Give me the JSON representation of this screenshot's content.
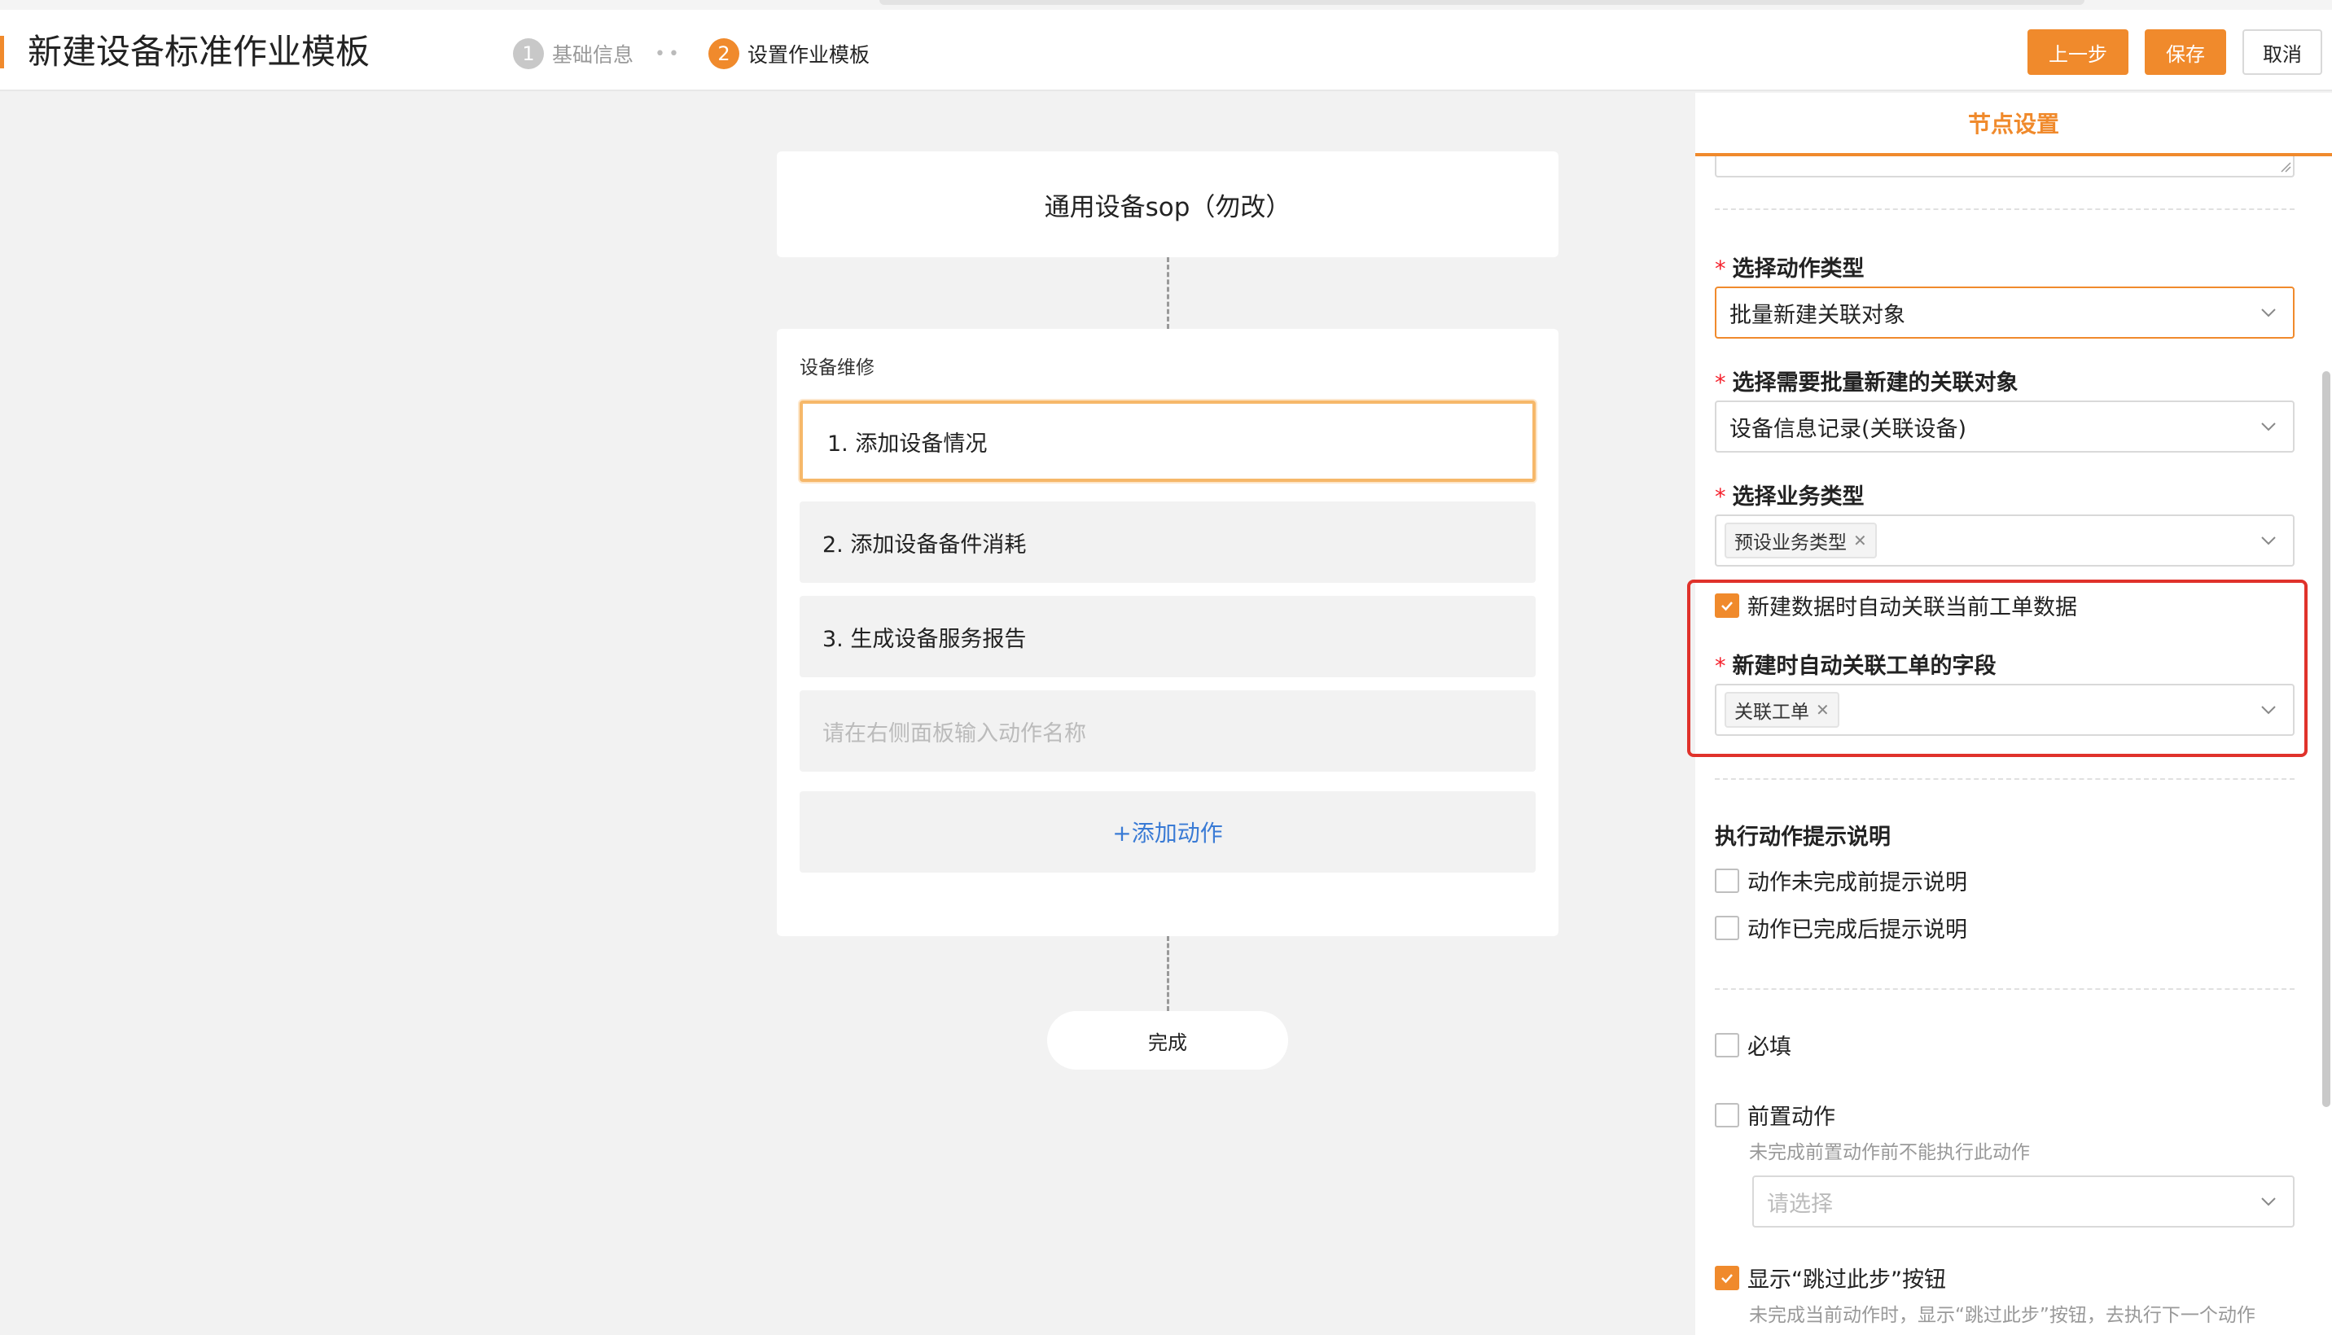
{
  "header": {
    "title": "新建设备标准作业模板",
    "steps": [
      {
        "num": "1",
        "label": "基础信息"
      },
      {
        "num": "2",
        "label": "设置作业模板"
      }
    ],
    "step_separator": "••",
    "buttons": {
      "prev": "上一步",
      "save": "保存",
      "cancel": "取消"
    }
  },
  "canvas": {
    "template_name": "通用设备sop（勿改）",
    "category": "设备维修",
    "actions": [
      "1. 添加设备情况",
      "2. 添加设备备件消耗",
      "3. 生成设备服务报告"
    ],
    "action_placeholder": "请在右侧面板输入动作名称",
    "add_action": "+添加动作",
    "end_node": "完成"
  },
  "panel": {
    "title": "节点设置",
    "action_type": {
      "label": "选择动作类型",
      "value": "批量新建关联对象"
    },
    "batch_object": {
      "label": "选择需要批量新建的关联对象",
      "value": "设备信息记录(关联设备)"
    },
    "business_type": {
      "label": "选择业务类型",
      "tag": "预设业务类型"
    },
    "auto_link_checkbox": "新建数据时自动关联当前工单数据",
    "auto_link_field": {
      "label": "新建时自动关联工单的字段",
      "tag": "关联工单"
    },
    "exec_hint": {
      "label": "执行动作提示说明",
      "before": "动作未完成前提示说明",
      "after": "动作已完成后提示说明"
    },
    "required": "必填",
    "pre_action": {
      "label": "前置动作",
      "hint": "未完成前置动作前不能执行此动作",
      "placeholder": "请选择"
    },
    "skip_button": {
      "label": "显示“跳过此步”按钮",
      "hint": "未完成当前动作时，显示“跳过此步”按钮，去执行下一个动作"
    }
  },
  "colors": {
    "accent": "#f08a2c",
    "highlight": "#e0322b",
    "link": "#3a7bd5"
  }
}
